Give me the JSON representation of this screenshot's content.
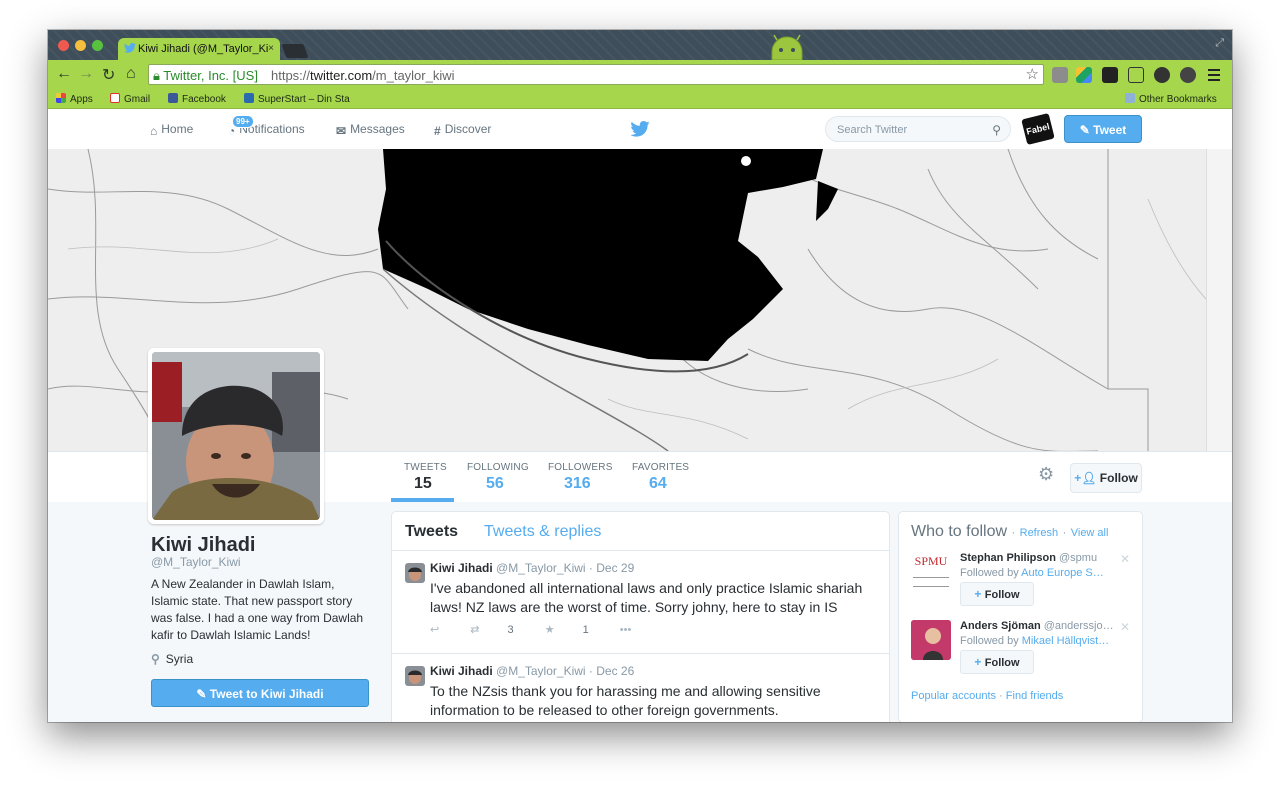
{
  "browser": {
    "tab_title": "Kiwi Jihadi (@M_Taylor_Ki",
    "tab_close": "×",
    "ev_label": "Twitter, Inc. [US]",
    "url_scheme": "https://",
    "url_host": "twitter.com",
    "url_path": "/m_taylor_kiwi",
    "bookmarks": [
      "Apps",
      "Gmail",
      "Facebook",
      "SuperStart – Din Sta"
    ],
    "other_bookmarks": "Other Bookmarks",
    "colors": {
      "chrome_theme": "#a6d64c",
      "titlebar": "#3e4e5a"
    }
  },
  "twitter_nav": {
    "home": "Home",
    "notifications": "Notifications",
    "notifications_badge": "99+",
    "messages": "Messages",
    "discover": "Discover",
    "search_placeholder": "Search Twitter",
    "account_avatar_text": "Fabel",
    "tweet_button": "Tweet"
  },
  "profile_nav": {
    "stats": [
      {
        "label": "TWEETS",
        "value": "15"
      },
      {
        "label": "FOLLOWING",
        "value": "56"
      },
      {
        "label": "FOLLOWERS",
        "value": "316"
      },
      {
        "label": "FAVORITES",
        "value": "64"
      }
    ],
    "follow_button": "Follow"
  },
  "profile": {
    "name": "Kiwi Jihadi",
    "handle": "@M_Taylor_Kiwi",
    "bio": "A New Zealander in Dawlah Islam, Islamic state. That new passport story was false. I had a one way from Dawlah kafir to Dawlah Islamic Lands!",
    "location": "Syria",
    "tweet_to_button": "Tweet to Kiwi Jihadi"
  },
  "stream": {
    "tabs": [
      "Tweets",
      "Tweets & replies"
    ],
    "tweets": [
      {
        "name": "Kiwi Jihadi",
        "handle": "@M_Taylor_Kiwi",
        "date": "· Dec 29",
        "text": "I've abandoned all international laws and only practice Islamic shariah laws! NZ laws are the worst of time. Sorry johny, here to stay in IS",
        "retweets": "3",
        "favorites": "1"
      },
      {
        "name": "Kiwi Jihadi",
        "handle": "@M_Taylor_Kiwi",
        "date": "· Dec 26",
        "text": "To the NZsis thank you for harassing me and allowing sensitive information to be released to other foreign governments."
      }
    ]
  },
  "who_to_follow": {
    "title": "Who to follow",
    "refresh": "Refresh",
    "view_all": "View all",
    "sep": "·",
    "suggestions": [
      {
        "name": "Stephan Philipson",
        "handle": "@spmu",
        "followed_by_prefix": "Followed by",
        "followed_by": "Auto Europe S…",
        "follow": "Follow",
        "pic_text": "SPMU"
      },
      {
        "name": "Anders Sjöman",
        "handle": "@anderssjo…",
        "followed_by_prefix": "Followed by",
        "followed_by": "Mikael Hällqvist…",
        "follow": "Follow"
      }
    ],
    "popular": "Popular accounts",
    "find_friends": "Find friends"
  }
}
